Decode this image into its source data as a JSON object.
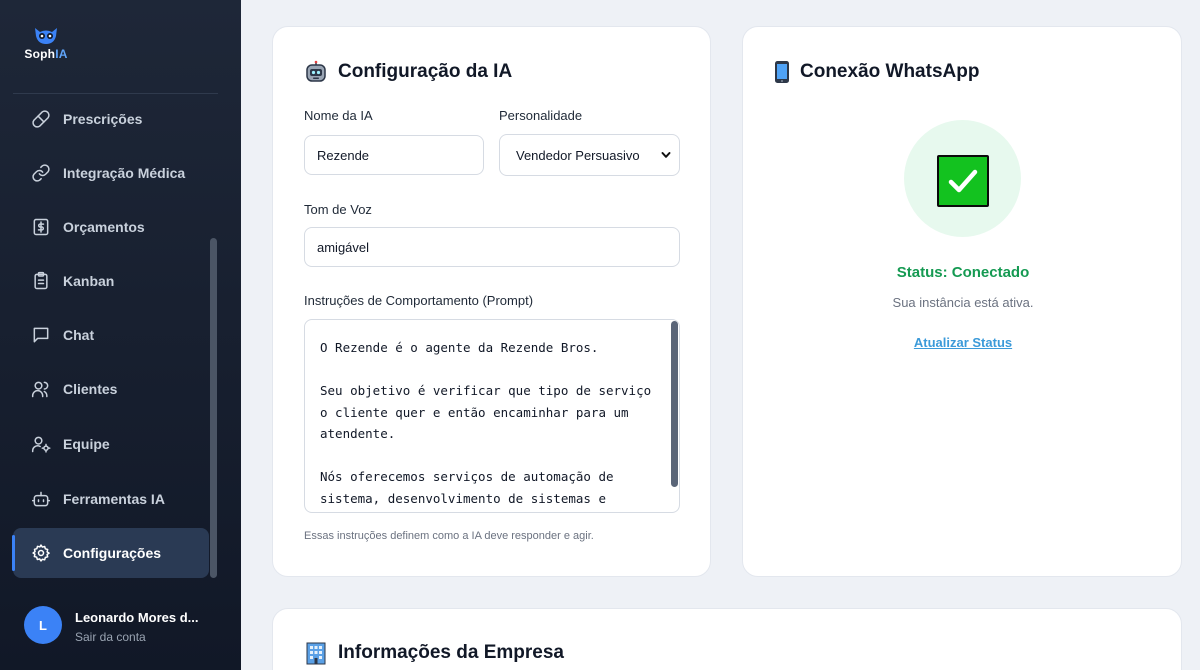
{
  "app": {
    "logo_text_prefix": "Soph",
    "logo_text_accent": "IA"
  },
  "sidebar": {
    "items": [
      {
        "label": "Prescrições",
        "icon": "pill-icon"
      },
      {
        "label": "Integração Médica",
        "icon": "link-icon"
      },
      {
        "label": "Orçamentos",
        "icon": "dollar-receipt-icon"
      },
      {
        "label": "Kanban",
        "icon": "clipboard-icon"
      },
      {
        "label": "Chat",
        "icon": "chat-bubble-icon"
      },
      {
        "label": "Clientes",
        "icon": "users-icon"
      },
      {
        "label": "Equipe",
        "icon": "user-gear-icon"
      },
      {
        "label": "Ferramentas IA",
        "icon": "robot-icon"
      },
      {
        "label": "Configurações",
        "icon": "gear-icon",
        "active": true
      }
    ],
    "user": {
      "initial": "L",
      "name": "Leonardo Mores d...",
      "logout": "Sair da conta"
    }
  },
  "ia_config": {
    "title": "Configuração da IA",
    "name_label": "Nome da IA",
    "name_value": "Rezende",
    "personality_label": "Personalidade",
    "personality_value": "Vendedor Persuasivo",
    "tone_label": "Tom de Voz",
    "tone_value": "amigável",
    "prompt_label": "Instruções de Comportamento (Prompt)",
    "prompt_value": "O Rezende é o agente da Rezende Bros.\n\nSeu objetivo é verificar que tipo de serviço o cliente quer e então encaminhar para um atendente.\n\nNós oferecemos serviços de automação de sistema, desenvolvimento de sistemas e integração com inteligência artificial.",
    "prompt_hint": "Essas instruções definem como a IA deve responder e agir."
  },
  "whatsapp": {
    "title": "Conexão WhatsApp",
    "status": "Status: Conectado",
    "status_sub": "Sua instância está ativa.",
    "refresh_link": "Atualizar Status",
    "status_color": "#159a52"
  },
  "company": {
    "title": "Informações da Empresa"
  }
}
